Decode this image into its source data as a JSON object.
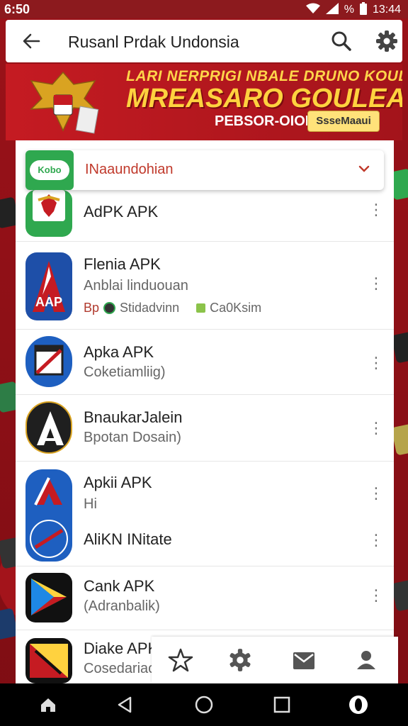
{
  "status_bar": {
    "time": "6:50",
    "battery": "%",
    "clock": "13:44"
  },
  "app_bar": {
    "title": "Rusanl Prdak Undonsia"
  },
  "banner": {
    "line1": "LARI NERPRIGI NBALE DRUNO KOUDON",
    "line2": "MREASARO GOULEA?",
    "promo": "PEBSOR-OIOIO",
    "cta": "SsseMaaui"
  },
  "dropdown": {
    "logo_text": "Kobo",
    "label": "INaaundohian"
  },
  "apps": [
    {
      "name": "AdPK APK"
    },
    {
      "name": "Flenia APK",
      "subtitle": "Anblai linduouan",
      "meta_prefix": "Bp",
      "meta_one": "Stidadvinn",
      "meta_two": "Ca0Ksim"
    },
    {
      "name": "Apka APK",
      "subtitle": "Coketiamliig)"
    },
    {
      "name": "BnaukarJalein",
      "subtitle": "Bpotan Dosain)"
    },
    {
      "name": "Apkii APK",
      "subtitle": "Hi"
    },
    {
      "name": "AliKN INitate"
    },
    {
      "name": "Cank APK",
      "subtitle": "(Adranbalik)"
    },
    {
      "name": "Diake APK",
      "subtitle": "Cosedariaoulnon"
    }
  ],
  "icon_logo_text": "AAP",
  "colors": {
    "brand_red": "#c51b22",
    "accent_yellow": "#ffd23f",
    "green": "#2fa84f"
  },
  "icons": [
    "back-arrow-icon",
    "search-icon",
    "gear-icon",
    "more-vert-icon",
    "chevron-down-icon",
    "star-outline-icon",
    "settings-icon",
    "mail-icon",
    "person-icon",
    "home-icon",
    "nav-back-icon",
    "nav-home-icon",
    "nav-recents-icon",
    "opera-icon"
  ]
}
